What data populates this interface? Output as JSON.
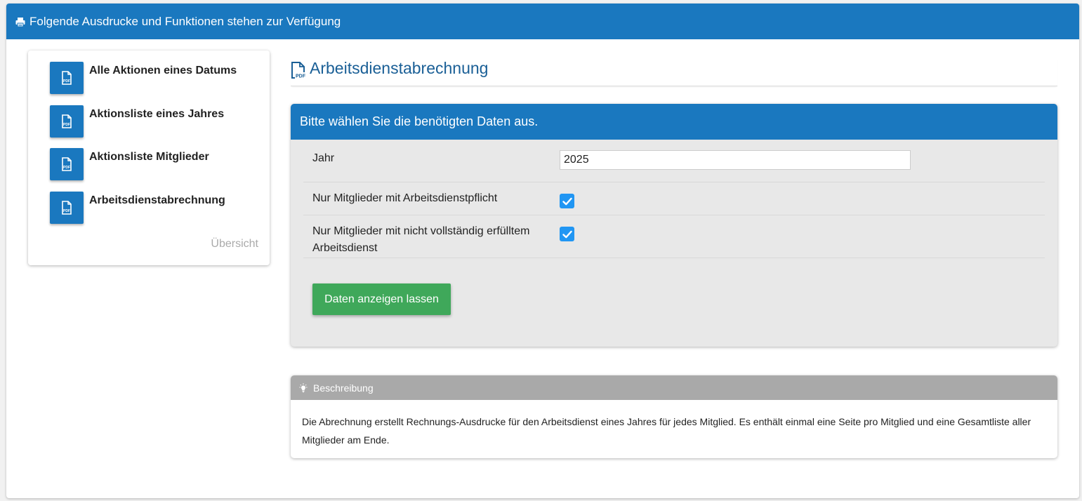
{
  "header": {
    "title": "Folgende Ausdrucke und Funktionen stehen zur Verfügung",
    "icon": "printer-icon"
  },
  "sidebar": {
    "items": [
      {
        "label": "Alle Aktionen eines Datums",
        "icon": "pdf-file-icon"
      },
      {
        "label": "Aktionsliste eines Jahres",
        "icon": "pdf-file-icon"
      },
      {
        "label": "Aktionsliste Mitglieder",
        "icon": "pdf-file-icon"
      },
      {
        "label": "Arbeitsdienstabrechnung",
        "icon": "pdf-file-icon"
      }
    ],
    "overview_link": "Übersicht"
  },
  "main": {
    "title": "Arbeitsdienstabrechnung",
    "title_icon": "pdf-file-icon",
    "form": {
      "header": "Bitte wählen Sie die benötigten Daten aus.",
      "year_label": "Jahr",
      "year_value": "2025",
      "checkbox1_label": "Nur Mitglieder mit Arbeitsdienstpflicht",
      "checkbox1_checked": true,
      "checkbox2_label_line1": "Nur Mitglieder mit nicht vollständig erfülltem",
      "checkbox2_label_line2": "Arbeitsdienst",
      "checkbox2_checked": true,
      "submit_label": "Daten anzeigen lassen"
    },
    "description": {
      "header": "Beschreibung",
      "icon": "lightbulb-icon",
      "text": "Die Abrechnung erstellt Rechnungs-Ausdrucke für den Arbeitsdienst eines Jahres für jedes Mitglied. Es enthält einmal eine Seite pro Mitglied und eine Gesamtliste aller Mitglieder am Ende."
    }
  },
  "colors": {
    "primary": "#1a78bf",
    "success": "#3fa85a",
    "checkbox": "#2196f3",
    "muted_header": "#a9a9a9",
    "title_text": "#1a5f96"
  }
}
